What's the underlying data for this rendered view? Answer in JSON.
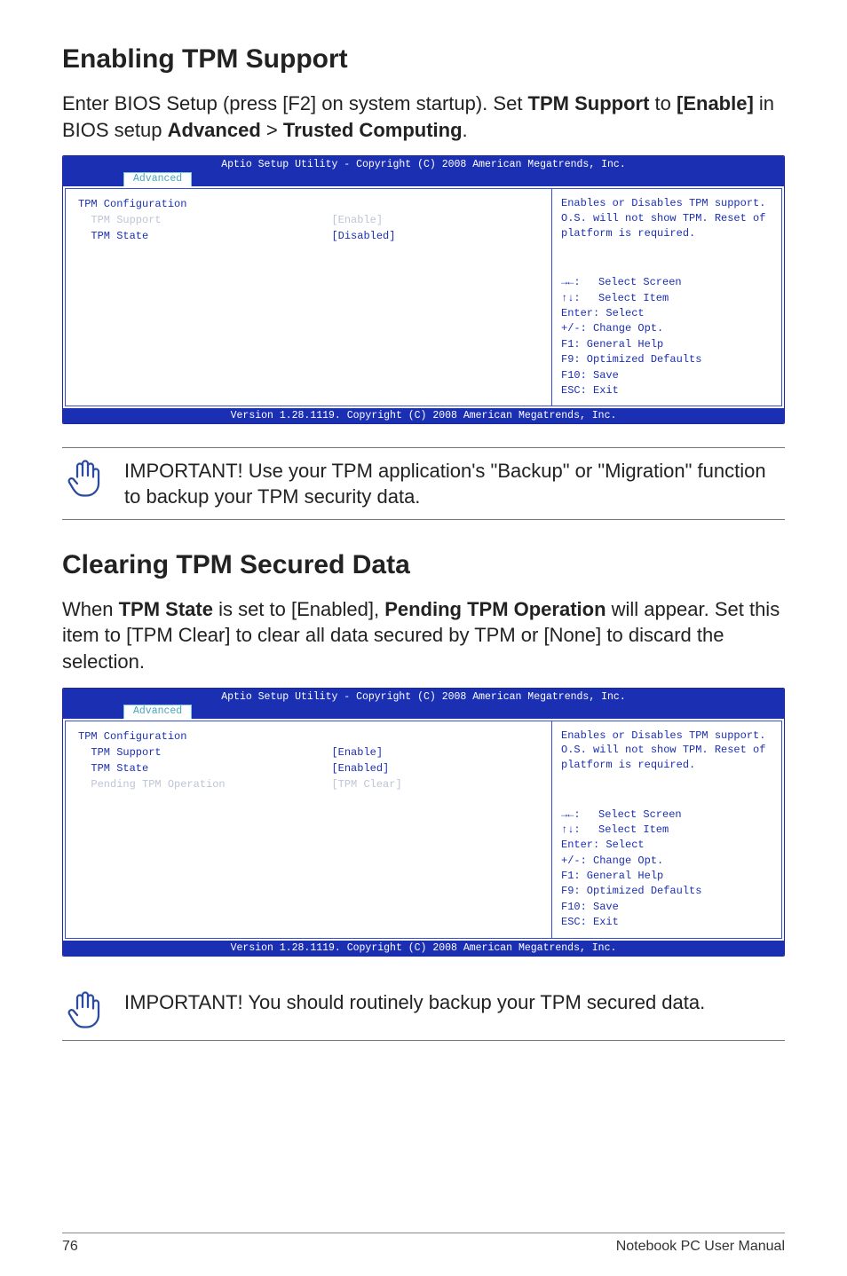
{
  "section1": {
    "title": "Enabling TPM Support",
    "intro_parts": {
      "p1": "Enter BIOS Setup (press [F2] on system startup). Set ",
      "b1": "TPM Support",
      "p2": " to ",
      "b2": "[Enable]",
      "p3": " in BIOS setup ",
      "b3": "Advanced",
      "p4": " > ",
      "b4": "Trusted Computing",
      "p5": "."
    }
  },
  "bios1": {
    "header_title": "Aptio Setup Utility - Copyright (C) 2008 American Megatrends, Inc.",
    "tab": "Advanced",
    "rows": [
      {
        "label": "TPM Configuration",
        "value": ""
      },
      {
        "label": "  TPM Support",
        "value": "[Enable]",
        "highlight": true
      },
      {
        "label": "  TPM State",
        "value": "[Disabled]"
      }
    ],
    "help": "Enables or Disables TPM support. O.S. will not show TPM. Reset of platform is required.",
    "keys": {
      "selscreen": "Select Screen",
      "selitem": "Select Item",
      "enter": "Enter: Select",
      "change": "+/-:  Change Opt.",
      "f1": "F1:   General Help",
      "f9": "F9:   Optimized Defaults",
      "f10": "F10:  Save",
      "esc": "ESC:  Exit"
    },
    "footer": "Version 1.28.1119. Copyright (C) 2008 American Megatrends, Inc."
  },
  "note1": "IMPORTANT! Use your TPM application's \"Backup\" or \"Migration\" function to backup your TPM security data.",
  "section2": {
    "title": "Clearing TPM Secured Data",
    "intro_parts": {
      "p1": "When ",
      "b1": "TPM State",
      "p2": " is set to [Enabled], ",
      "b2": "Pending TPM Operation",
      "p3": " will appear. Set this item to [TPM Clear] to clear all data secured by TPM or [None] to discard the selection."
    }
  },
  "bios2": {
    "header_title": "Aptio Setup Utility - Copyright (C) 2008 American Megatrends, Inc.",
    "tab": "Advanced",
    "rows": [
      {
        "label": "TPM Configuration",
        "value": ""
      },
      {
        "label": "  TPM Support",
        "value": "[Enable]"
      },
      {
        "label": "  TPM State",
        "value": "[Enabled]"
      },
      {
        "label": "  Pending TPM Operation",
        "value": "[TPM Clear]",
        "highlight": true
      }
    ],
    "help": "Enables or Disables TPM support. O.S. will not show TPM. Reset of platform is required.",
    "keys": {
      "selscreen": "Select Screen",
      "selitem": "Select Item",
      "enter": "Enter: Select",
      "change": "+/-:  Change Opt.",
      "f1": "F1:   General Help",
      "f9": "F9:   Optimized Defaults",
      "f10": "F10:  Save",
      "esc": "ESC:  Exit"
    },
    "footer": "Version 1.28.1119. Copyright (C) 2008 American Megatrends, Inc."
  },
  "note2": "IMPORTANT! You should routinely backup your TPM secured data.",
  "footer": {
    "page": "76",
    "label": "Notebook PC User Manual"
  },
  "arrows": {
    "lr": "→←:",
    "ud": "↑↓:"
  }
}
